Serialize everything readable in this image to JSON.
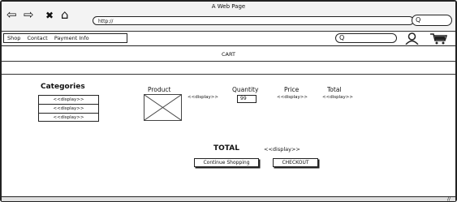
{
  "window": {
    "title": "A Web Page"
  },
  "browser": {
    "url": "http://",
    "search_glyph": "Q",
    "back_icon": "⇦",
    "forward_icon": "⇨",
    "close_icon": "✖",
    "home_icon": "⌂"
  },
  "menu": {
    "items": [
      "Shop",
      "Contact",
      "Payment Info"
    ],
    "search_glyph": "Q"
  },
  "page": {
    "title": "CART"
  },
  "categories": {
    "heading": "Categories",
    "items": [
      "<<display>>",
      "<<display>>",
      "<<display>>"
    ]
  },
  "columns": {
    "product": "Product",
    "quantity": "Quantity",
    "price": "Price",
    "total": "Total"
  },
  "item": {
    "product_display": "<<display>>",
    "quantity": "99",
    "price_display": "<<display>>",
    "total_display": "<<display>>"
  },
  "summary": {
    "total_label": "TOTAL",
    "total_value": "<<display>>"
  },
  "buttons": {
    "continue": "Continue Shopping",
    "checkout": "CHECKOUT"
  },
  "colors": {
    "ink": "#222222",
    "chrome": "#f3f3f3",
    "statusbar": "#e0e0e0"
  }
}
